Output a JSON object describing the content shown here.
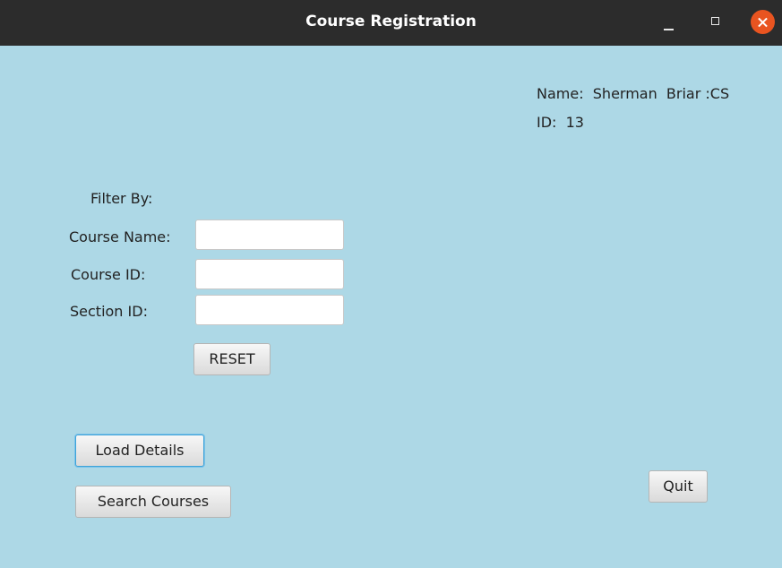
{
  "window": {
    "title": "Course Registration"
  },
  "user": {
    "name_line": "Name:  Sherman  Briar :CS",
    "id_line": "ID:  13"
  },
  "filter": {
    "heading": "Filter By:",
    "course_name_label": "Course Name:",
    "course_name_value": "",
    "course_id_label": "Course ID:",
    "course_id_value": "",
    "section_id_label": "Section ID:",
    "section_id_value": "",
    "reset_label": "RESET"
  },
  "actions": {
    "load_details_label": "Load Details",
    "search_courses_label": "Search Courses",
    "quit_label": "Quit"
  },
  "colors": {
    "background": "#add8e6",
    "titlebar": "#2c2c2c",
    "close_button": "#e95420",
    "focus_ring": "#3ea3d8"
  }
}
